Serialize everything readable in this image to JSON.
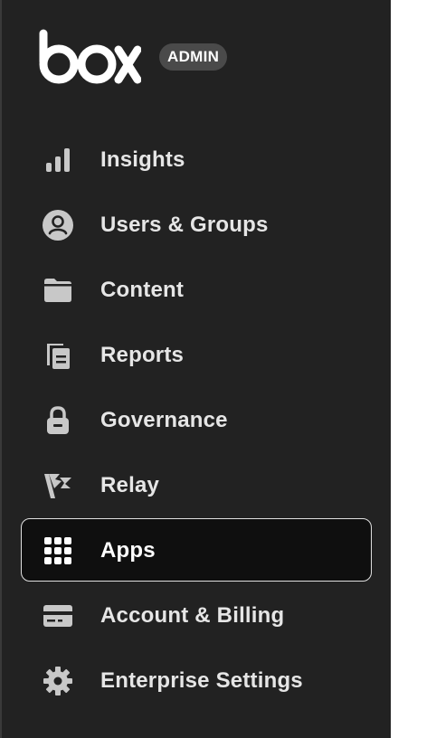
{
  "brand": {
    "logo_text": "box",
    "badge": "ADMIN"
  },
  "nav": {
    "items": [
      {
        "label": "Insights",
        "icon": "bar-chart-icon",
        "active": false
      },
      {
        "label": "Users & Groups",
        "icon": "user-circle-icon",
        "active": false
      },
      {
        "label": "Content",
        "icon": "folder-icon",
        "active": false
      },
      {
        "label": "Reports",
        "icon": "documents-icon",
        "active": false
      },
      {
        "label": "Governance",
        "icon": "lock-icon",
        "active": false
      },
      {
        "label": "Relay",
        "icon": "relay-flag-icon",
        "active": false
      },
      {
        "label": "Apps",
        "icon": "grid-icon",
        "active": true
      },
      {
        "label": "Account & Billing",
        "icon": "credit-card-icon",
        "active": false
      },
      {
        "label": "Enterprise Settings",
        "icon": "gear-icon",
        "active": false
      }
    ]
  },
  "colors": {
    "sidebar_bg": "#222222",
    "active_bg": "#0f0f0f",
    "icon": "#c8c8c8",
    "label": "#e6e6e6"
  }
}
